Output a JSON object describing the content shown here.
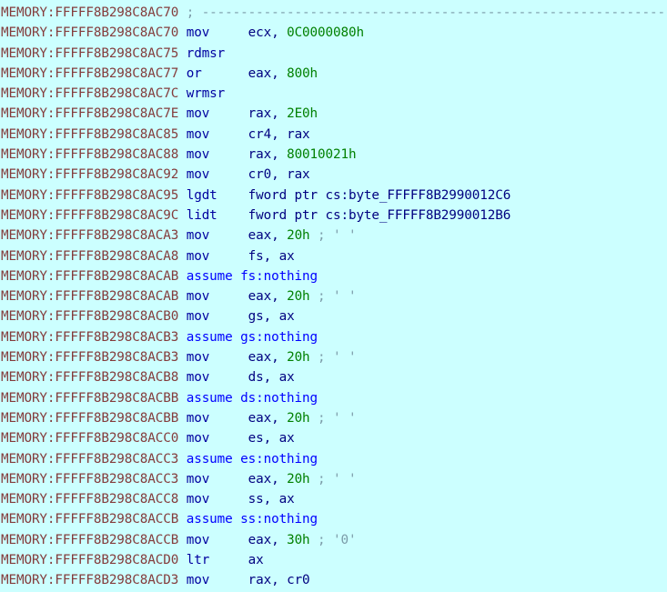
{
  "view": {
    "name": "IDA Pro disassembly listing",
    "segment": "MEMORY",
    "background_color": "#ccffff",
    "colors": {
      "address": "#843C3C",
      "mnemonic": "#0000A0",
      "register": "#000080",
      "immediate": "#008000",
      "keyword": "#0000FF",
      "comment": "#7B9BA8"
    }
  },
  "lines": [
    {
      "addr": "MEMORY:FFFFF8B298C8AC70",
      "kind": "comment",
      "comment": "; ------------------------------------------------------------------"
    },
    {
      "addr": "MEMORY:FFFFF8B298C8AC70",
      "kind": "insn",
      "mnemonic": "mov",
      "op1": "ecx",
      "op1_kind": "reg",
      "op2": "0C0000080h",
      "op2_kind": "imm"
    },
    {
      "addr": "MEMORY:FFFFF8B298C8AC75",
      "kind": "insn",
      "mnemonic": "rdmsr"
    },
    {
      "addr": "MEMORY:FFFFF8B298C8AC77",
      "kind": "insn",
      "mnemonic": "or",
      "op1": "eax",
      "op1_kind": "reg",
      "op2": "800h",
      "op2_kind": "imm"
    },
    {
      "addr": "MEMORY:FFFFF8B298C8AC7C",
      "kind": "insn",
      "mnemonic": "wrmsr"
    },
    {
      "addr": "MEMORY:FFFFF8B298C8AC7E",
      "kind": "insn",
      "mnemonic": "mov",
      "op1": "rax",
      "op1_kind": "reg",
      "op2": "2E0h",
      "op2_kind": "imm"
    },
    {
      "addr": "MEMORY:FFFFF8B298C8AC85",
      "kind": "insn",
      "mnemonic": "mov",
      "op1": "cr4",
      "op1_kind": "reg",
      "op2": "rax",
      "op2_kind": "reg"
    },
    {
      "addr": "MEMORY:FFFFF8B298C8AC88",
      "kind": "insn",
      "mnemonic": "mov",
      "op1": "rax",
      "op1_kind": "reg",
      "op2": "80010021h",
      "op2_kind": "imm"
    },
    {
      "addr": "MEMORY:FFFFF8B298C8AC92",
      "kind": "insn",
      "mnemonic": "mov",
      "op1": "cr0",
      "op1_kind": "reg",
      "op2": "rax",
      "op2_kind": "reg"
    },
    {
      "addr": "MEMORY:FFFFF8B298C8AC95",
      "kind": "insn",
      "mnemonic": "lgdt",
      "op1": "fword ptr cs:byte_FFFFF8B2990012C6",
      "op1_kind": "ptr"
    },
    {
      "addr": "MEMORY:FFFFF8B298C8AC9C",
      "kind": "insn",
      "mnemonic": "lidt",
      "op1": "fword ptr cs:byte_FFFFF8B2990012B6",
      "op1_kind": "ptr"
    },
    {
      "addr": "MEMORY:FFFFF8B298C8ACA3",
      "kind": "insn",
      "mnemonic": "mov",
      "op1": "eax",
      "op1_kind": "reg",
      "op2": "20h",
      "op2_kind": "imm",
      "comment": "; ' '"
    },
    {
      "addr": "MEMORY:FFFFF8B298C8ACA8",
      "kind": "insn",
      "mnemonic": "mov",
      "op1": "fs",
      "op1_kind": "reg",
      "op2": "ax",
      "op2_kind": "reg"
    },
    {
      "addr": "MEMORY:FFFFF8B298C8ACAB",
      "kind": "directive",
      "text": "assume fs:nothing"
    },
    {
      "addr": "MEMORY:FFFFF8B298C8ACAB",
      "kind": "insn",
      "mnemonic": "mov",
      "op1": "eax",
      "op1_kind": "reg",
      "op2": "20h",
      "op2_kind": "imm",
      "comment": "; ' '"
    },
    {
      "addr": "MEMORY:FFFFF8B298C8ACB0",
      "kind": "insn",
      "mnemonic": "mov",
      "op1": "gs",
      "op1_kind": "reg",
      "op2": "ax",
      "op2_kind": "reg"
    },
    {
      "addr": "MEMORY:FFFFF8B298C8ACB3",
      "kind": "directive",
      "text": "assume gs:nothing"
    },
    {
      "addr": "MEMORY:FFFFF8B298C8ACB3",
      "kind": "insn",
      "mnemonic": "mov",
      "op1": "eax",
      "op1_kind": "reg",
      "op2": "20h",
      "op2_kind": "imm",
      "comment": "; ' '"
    },
    {
      "addr": "MEMORY:FFFFF8B298C8ACB8",
      "kind": "insn",
      "mnemonic": "mov",
      "op1": "ds",
      "op1_kind": "reg",
      "op2": "ax",
      "op2_kind": "reg"
    },
    {
      "addr": "MEMORY:FFFFF8B298C8ACBB",
      "kind": "directive",
      "text": "assume ds:nothing"
    },
    {
      "addr": "MEMORY:FFFFF8B298C8ACBB",
      "kind": "insn",
      "mnemonic": "mov",
      "op1": "eax",
      "op1_kind": "reg",
      "op2": "20h",
      "op2_kind": "imm",
      "comment": "; ' '"
    },
    {
      "addr": "MEMORY:FFFFF8B298C8ACC0",
      "kind": "insn",
      "mnemonic": "mov",
      "op1": "es",
      "op1_kind": "reg",
      "op2": "ax",
      "op2_kind": "reg"
    },
    {
      "addr": "MEMORY:FFFFF8B298C8ACC3",
      "kind": "directive",
      "text": "assume es:nothing"
    },
    {
      "addr": "MEMORY:FFFFF8B298C8ACC3",
      "kind": "insn",
      "mnemonic": "mov",
      "op1": "eax",
      "op1_kind": "reg",
      "op2": "20h",
      "op2_kind": "imm",
      "comment": "; ' '"
    },
    {
      "addr": "MEMORY:FFFFF8B298C8ACC8",
      "kind": "insn",
      "mnemonic": "mov",
      "op1": "ss",
      "op1_kind": "reg",
      "op2": "ax",
      "op2_kind": "reg"
    },
    {
      "addr": "MEMORY:FFFFF8B298C8ACCB",
      "kind": "directive",
      "text": "assume ss:nothing"
    },
    {
      "addr": "MEMORY:FFFFF8B298C8ACCB",
      "kind": "insn",
      "mnemonic": "mov",
      "op1": "eax",
      "op1_kind": "reg",
      "op2": "30h",
      "op2_kind": "imm",
      "comment": "; '0'"
    },
    {
      "addr": "MEMORY:FFFFF8B298C8ACD0",
      "kind": "insn",
      "mnemonic": "ltr",
      "op1": "ax",
      "op1_kind": "reg"
    },
    {
      "addr": "MEMORY:FFFFF8B298C8ACD3",
      "kind": "insn",
      "mnemonic": "mov",
      "op1": "rax",
      "op1_kind": "reg",
      "op2": "cr0",
      "op2_kind": "reg"
    }
  ]
}
